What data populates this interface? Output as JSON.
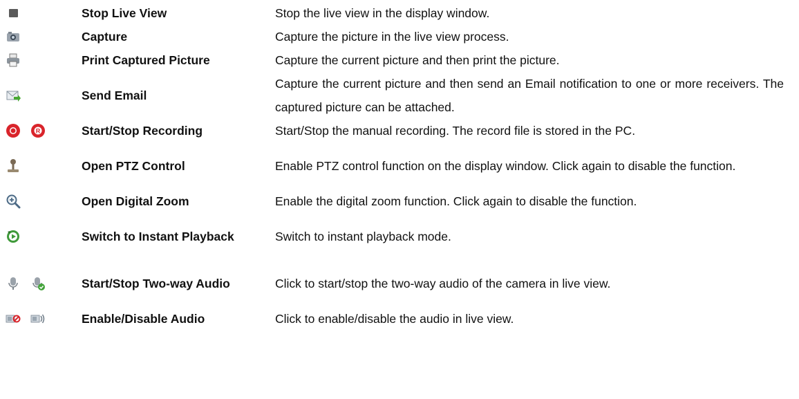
{
  "rows": [
    {
      "label": "Stop Live View",
      "desc": "Stop the live view in the display window.",
      "icons": [
        "stop-live-view-icon"
      ]
    },
    {
      "label": "Capture",
      "desc": "Capture the picture in the live view process.",
      "icons": [
        "camera-icon"
      ]
    },
    {
      "label": "Print Captured Picture",
      "desc": "Capture the current picture and then print the picture.",
      "icons": [
        "printer-icon"
      ]
    },
    {
      "label": "Send Email",
      "desc": "Capture the current picture and then send an Email notification to one or more receivers. The captured picture can be attached.",
      "icons": [
        "email-icon"
      ]
    },
    {
      "label": "Start/Stop Recording",
      "desc": "Start/Stop the manual recording. The record file is stored in the PC.",
      "icons": [
        "record-start-icon",
        "record-stop-icon"
      ]
    },
    {
      "label": "Open PTZ Control",
      "desc": "Enable PTZ control function on the display window. Click again to disable the function.",
      "icons": [
        "ptz-joystick-icon"
      ]
    },
    {
      "label": "Open Digital Zoom",
      "desc": "Enable the digital zoom function. Click again to disable the function.",
      "icons": [
        "zoom-in-icon"
      ]
    },
    {
      "label": "Switch to Instant Playback",
      "desc": "Switch to instant playback mode.",
      "icons": [
        "instant-playback-icon"
      ]
    },
    {
      "label": "Start/Stop Two-way Audio",
      "desc": "Click to start/stop the two-way audio of the camera in live view.",
      "icons": [
        "microphone-icon",
        "microphone-active-icon"
      ]
    },
    {
      "label": "Enable/Disable Audio",
      "desc": "Click to enable/disable the audio in live view.",
      "icons": [
        "speaker-muted-icon",
        "speaker-on-icon"
      ]
    }
  ]
}
